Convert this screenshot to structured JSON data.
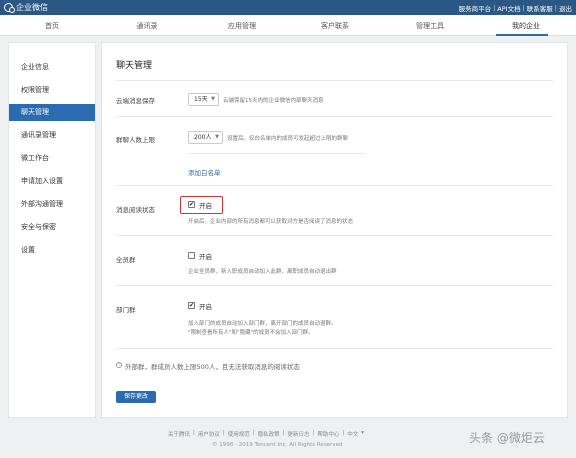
{
  "topbar": {
    "app_name": "企业微信",
    "links": [
      "服务商平台",
      "API文档",
      "联系客服",
      "退出"
    ],
    "separator": "|",
    "bg_color": "#2b5785"
  },
  "nav": {
    "items": [
      "首页",
      "通讯录",
      "应用管理",
      "客户联系",
      "管理工具",
      "我的企业"
    ],
    "active": "我的企业"
  },
  "sidebar": {
    "items": [
      "企业信息",
      "权限管理",
      "聊天管理",
      "通讯录管理",
      "微工作台",
      "申请加入设置",
      "外部沟通管理",
      "安全与保密",
      "设置"
    ],
    "active": "聊天管理"
  },
  "main": {
    "title": "聊天管理",
    "cloud_storage": {
      "label": "云端消息保存",
      "value": "15天",
      "hint": "云端保留15天内的企业微信内部聊天消息"
    },
    "group_limit": {
      "label": "群聊人数上限",
      "value": "200人",
      "hint": "设置后，仅白名单内的成员可发起超过上限的群聊",
      "link": "添加白名单"
    },
    "read_status": {
      "label": "消息阅读状态",
      "checkbox_label": "开启",
      "checked": true,
      "hint": "开启后，企业内部的所有消息都可以获取对方是否阅读了消息的状态"
    },
    "all_staff_group": {
      "label": "全员群",
      "checkbox_label": "开启",
      "checked": false,
      "hint": "企业全员群，新入职成员自动加入此群，离职成员自动退出群"
    },
    "dept_group": {
      "label": "部门群",
      "checkbox_label": "开启",
      "checked": true,
      "hint_line1": "加入部门的成员自动加入部门群，离开部门的成员自动退群。",
      "hint_line2": "\"限制查看所有人\"和\"隐藏\"的成员不会加入部门群。"
    },
    "external_note": "外部群，群成员人数上限500人，且无法获取消息的阅读状态",
    "save_button": "保存更改"
  },
  "footer": {
    "links": [
      "关于腾讯",
      "|",
      "用户协议",
      "|",
      "使用规范",
      "|",
      "隐私政策",
      "|",
      "更新日志",
      "|",
      "帮助中心",
      "|",
      "中文"
    ],
    "copyright": "© 1998 - 2019 Tencent Inc. All Rights Reserved"
  },
  "watermark": "头条 @微炬云",
  "accent_color": "#2b6cb0",
  "highlight_color": "#d9302f"
}
